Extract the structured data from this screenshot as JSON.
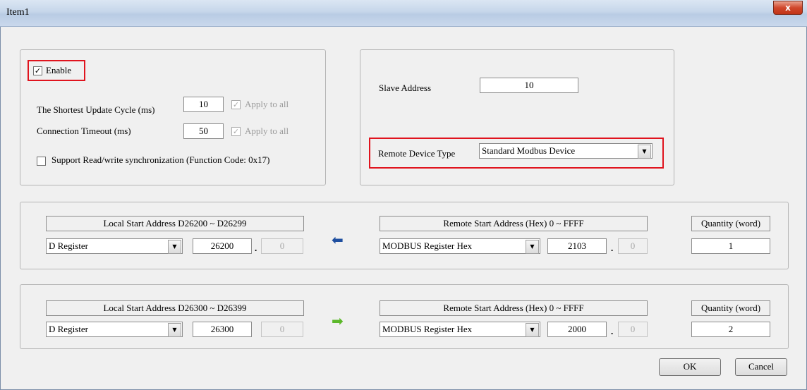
{
  "window": {
    "title": "Item1",
    "close_glyph": "x"
  },
  "general": {
    "enable_label": "Enable",
    "enable_checked": true,
    "update_cycle_label": "The Shortest Update Cycle (ms)",
    "update_cycle_value": "10",
    "timeout_label": "Connection Timeout (ms)",
    "timeout_value": "50",
    "apply_all_label": "Apply to all",
    "sync_label": "Support Read/write synchronization (Function Code: 0x17)",
    "sync_checked": false,
    "check_glyph": "✓"
  },
  "slave": {
    "address_label": "Slave Address",
    "address_value": "10",
    "device_type_label": "Remote Device Type",
    "device_type_value": "Standard Modbus Device"
  },
  "mappings": [
    {
      "local_header": "Local Start Address D26200 ~ D26299",
      "local_type": "D Register",
      "local_address": "26200",
      "local_bit": "0",
      "direction": "read",
      "arrow_glyph": "⬅",
      "arrow_color": "#1f4fa0",
      "remote_header": "Remote Start Address (Hex) 0 ~ FFFF",
      "remote_type": "MODBUS Register Hex",
      "remote_address": "2103",
      "remote_bit": "0",
      "quantity_header": "Quantity (word)",
      "quantity": "1"
    },
    {
      "local_header": "Local Start Address D26300 ~ D26399",
      "local_type": "D Register",
      "local_address": "26300",
      "local_bit": "0",
      "direction": "write",
      "arrow_glyph": "➡",
      "arrow_color": "#5cb82a",
      "remote_header": "Remote Start Address (Hex) 0 ~ FFFF",
      "remote_type": "MODBUS Register Hex",
      "remote_address": "2000",
      "remote_bit": "0",
      "quantity_header": "Quantity (word)",
      "quantity": "2"
    }
  ],
  "buttons": {
    "ok": "OK",
    "cancel": "Cancel"
  },
  "dot_glyph": ".",
  "dropdown_glyph": "▼",
  "colors": {
    "highlight": "#e0141e",
    "title_gradient": "#c6d6ea"
  }
}
